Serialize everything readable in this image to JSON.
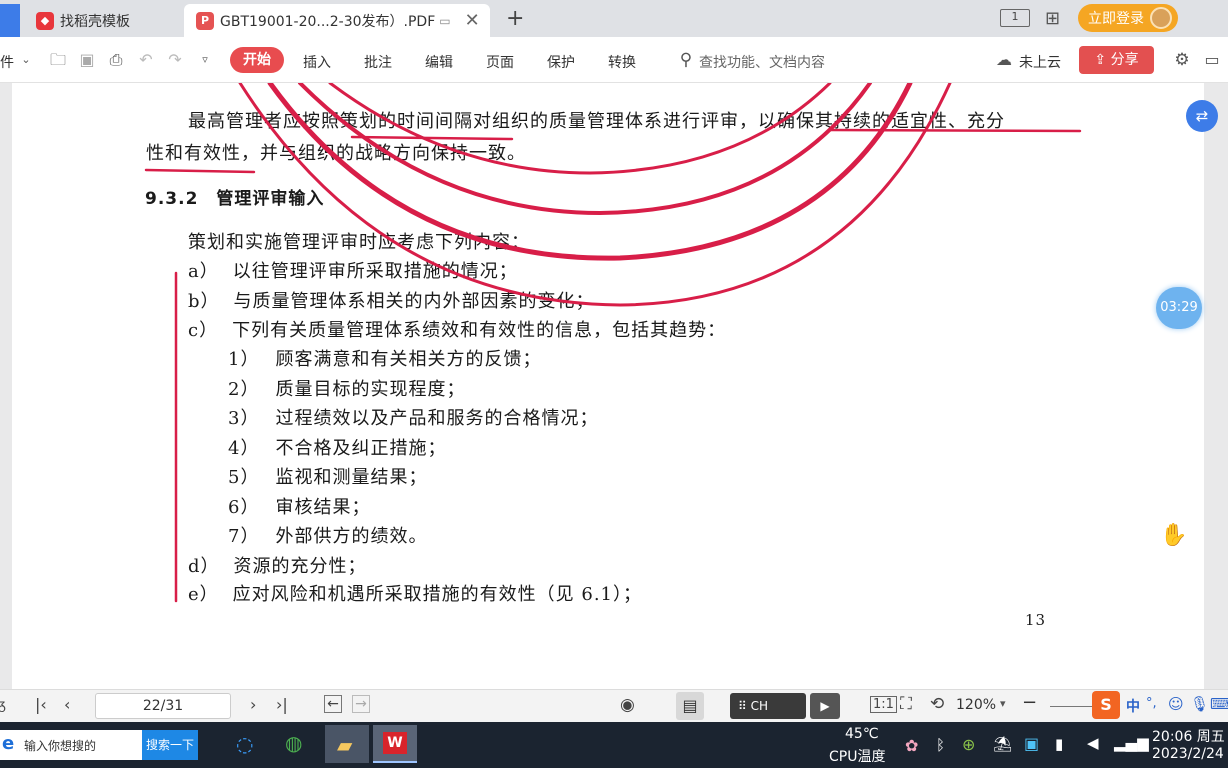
{
  "tabs": [
    {
      "label": "找稻壳模板"
    },
    {
      "label": "GBT19001-20...2-30发布）.PDF"
    }
  ],
  "header": {
    "login": "立即登录",
    "window_badge": "1"
  },
  "toolbar": {
    "left_fragment": "件",
    "menu": [
      "开始",
      "插入",
      "批注",
      "编辑",
      "页面",
      "保护",
      "转换"
    ],
    "search_placeholder": "查找功能、文档内容",
    "cloud": "未上云",
    "share": "分享"
  },
  "document": {
    "para1_line1": "最高管理者应按照策划的时间间隔对组织的质量管理体系进行评审，以确保其持续的适宜性、充分",
    "para1_line2": "性和有效性，并与组织的战略方向保持一致。",
    "section_heading": "9.3.2　管理评审输入",
    "intro": "策划和实施管理评审时应考虑下列内容：",
    "items": [
      {
        "mark": "a）",
        "text": "以往管理评审所采取措施的情况；"
      },
      {
        "mark": "b）",
        "text": "与质量管理体系相关的内外部因素的变化；"
      },
      {
        "mark": "c）",
        "text": "下列有关质量管理体系绩效和有效性的信息，包括其趋势："
      }
    ],
    "subitems": [
      {
        "mark": "1）",
        "text": "顾客满意和有关相关方的反馈；"
      },
      {
        "mark": "2）",
        "text": "质量目标的实现程度；"
      },
      {
        "mark": "3）",
        "text": "过程绩效以及产品和服务的合格情况；"
      },
      {
        "mark": "4）",
        "text": "不合格及纠正措施；"
      },
      {
        "mark": "5）",
        "text": "监视和测量结果；"
      },
      {
        "mark": "6）",
        "text": "审核结果；"
      },
      {
        "mark": "7）",
        "text": "外部供方的绩效。"
      }
    ],
    "items2": [
      {
        "mark": "d）",
        "text": "资源的充分性；"
      },
      {
        "mark": "e）",
        "text": "应对风险和机遇所采取措施的有效性（见 6.1）；"
      }
    ],
    "page_number": "13"
  },
  "timer": "03:29",
  "statusbar": {
    "page_input": "22/31",
    "ime": "CH",
    "zoom": "120%",
    "tray_chars": [
      "中",
      "°,"
    ]
  },
  "taskbar": {
    "search_placeholder": "输入你想搜的",
    "search_button": "搜索一下",
    "temp": "45℃",
    "temp_label": "CPU温度",
    "time": "20:06 周五",
    "date": "2023/2/24"
  },
  "colors": {
    "accent": "#e84c4f",
    "share_bg": "#e35050",
    "login_bg": "#f5a623",
    "annotation": "#d81e48"
  }
}
